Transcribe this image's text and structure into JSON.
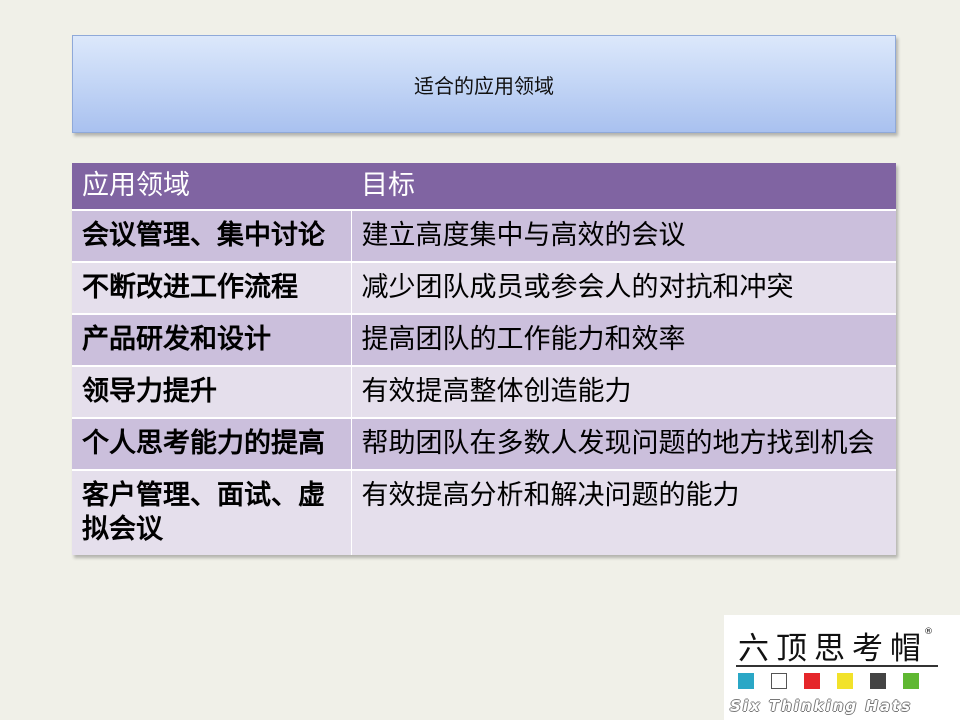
{
  "title": "适合的应用领域",
  "table": {
    "header": [
      "应用领域",
      "目标"
    ],
    "rows": [
      [
        "会议管理、集中讨论",
        "建立高度集中与高效的会议"
      ],
      [
        "不断改进工作流程",
        "减少团队成员或参会人的对抗和冲突"
      ],
      [
        "产品研发和设计",
        "提高团队的工作能力和效率"
      ],
      [
        "领导力提升",
        "有效提高整体创造能力"
      ],
      [
        "个人思考能力的提高",
        "帮助团队在多数人发现问题的地方找到机会"
      ],
      [
        "客户管理、面试、虚拟会议",
        "有效提高分析和解决问题的能力"
      ]
    ]
  },
  "logo": {
    "cn": "六顶思考帽",
    "en": "Six Thinking Hats",
    "reg": "®",
    "hat_colors": [
      "#2aa7c6",
      "#ffffff",
      "#e5262a",
      "#f2e22a",
      "#444444",
      "#5fb832"
    ]
  },
  "colors": {
    "header_bg": "#8064a2",
    "row_dark": "#cbbfdc",
    "row_light": "#e5dfec",
    "title_bg": "#c5d7f6"
  }
}
